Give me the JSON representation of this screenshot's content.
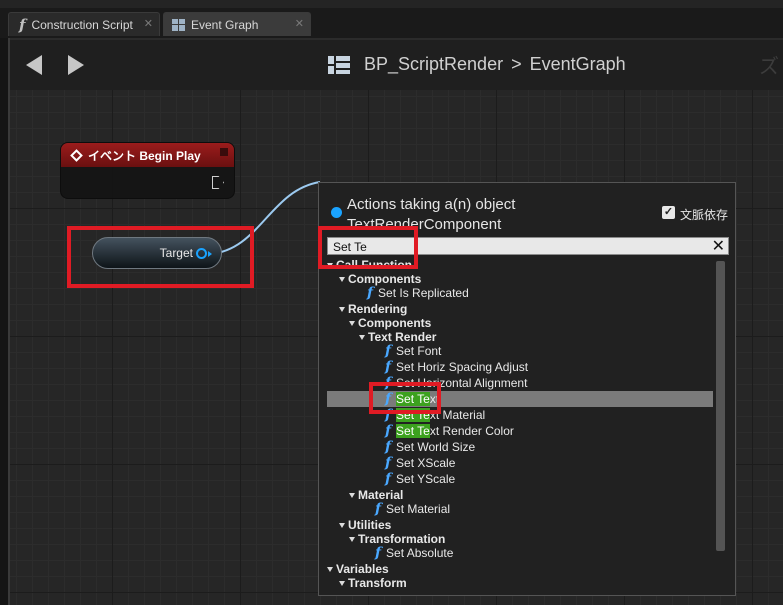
{
  "tabs": [
    {
      "label": "Construction Script",
      "icon": "function-icon"
    },
    {
      "label": "Event Graph",
      "icon": "graph-icon"
    }
  ],
  "toolbar": {
    "blueprint_name": "BP_ScriptRender",
    "graph_name": "EventGraph",
    "watermark_text": "ズ"
  },
  "nodes": {
    "begin_play_title": "イベント Begin Play",
    "target_label": "Target"
  },
  "context_menu": {
    "title_line1": "Actions taking a(n) object",
    "title_line2": "TextRenderComponent",
    "context_sensitive_label": "文脈依存",
    "context_sensitive_checked": true,
    "search_value": "Set Te",
    "selected_item": "Set Text",
    "items": {
      "call_function": "Call Function",
      "components": "Components",
      "set_is_replicated": "Set Is Replicated",
      "rendering": "Rendering",
      "rendering_components": "Components",
      "text_render": "Text Render",
      "set_font": "Set Font",
      "set_horiz_spacing": "Set Horiz Spacing Adjust",
      "set_horiz_alignment": "Set Horizontal Alignment",
      "set_text_pre": "Set Te",
      "set_text_post": "xt",
      "set_text_material_pre": "Set Te",
      "set_text_material_post": "xt Material",
      "set_text_render_color_pre": "Set Te",
      "set_text_render_color_post": "xt Render Color",
      "set_world_size": "Set World Size",
      "set_xscale": "Set XScale",
      "set_yscale": "Set YScale",
      "material": "Material",
      "set_material": "Set Material",
      "utilities": "Utilities",
      "transformation": "Transformation",
      "set_absolute": "Set Absolute",
      "variables": "Variables",
      "transform": "Transform"
    }
  },
  "colors": {
    "event_header": "#9b1c1c",
    "object_pin": "#1aa3ff",
    "search_highlight": "#3ca11e",
    "annotation_box": "#e01b24"
  }
}
